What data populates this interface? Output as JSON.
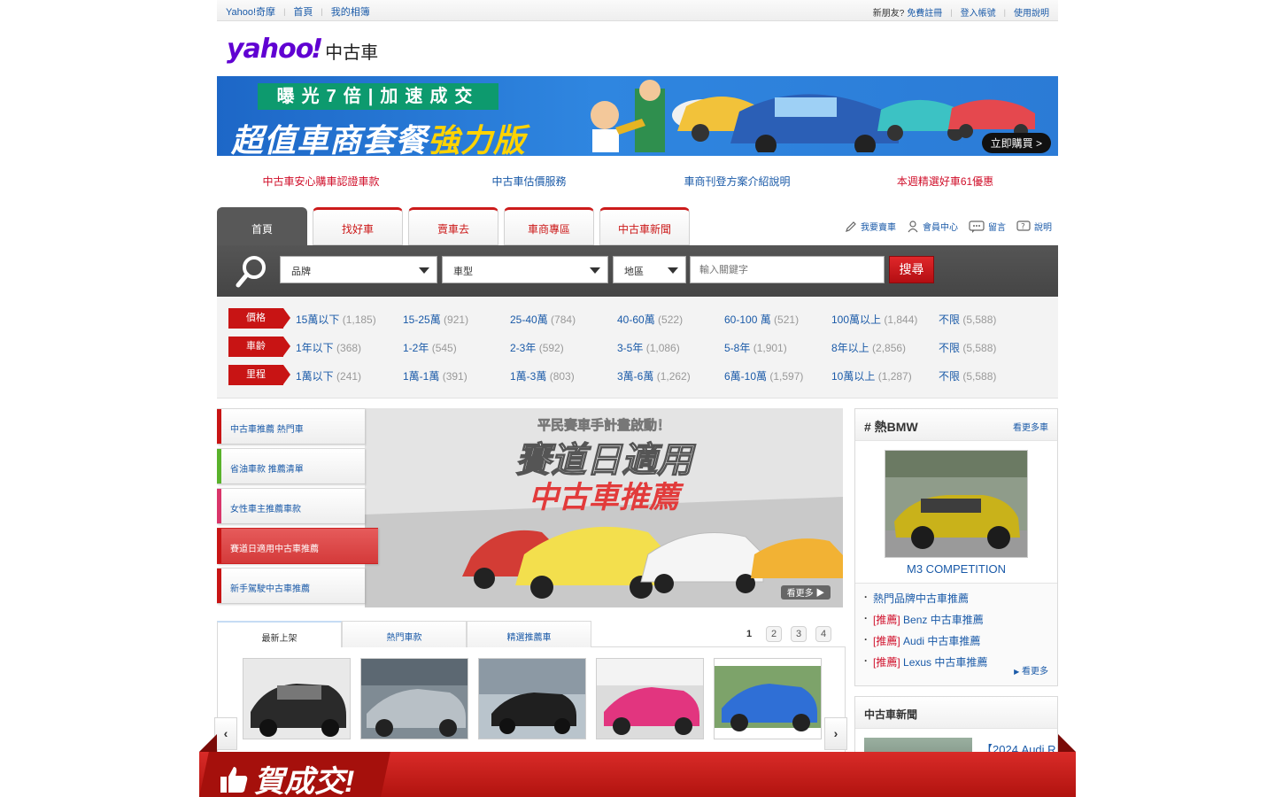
{
  "topbar": {
    "left_items": [
      "Yahoo!奇摩",
      "首頁",
      "我的相簿"
    ],
    "question": "新朋友?",
    "right_items": [
      "免費註冊",
      "登入帳號",
      "使用說明"
    ]
  },
  "logo": {
    "brand": "yahoo",
    "suffix": "中古車"
  },
  "banner": {
    "strip_text": "曝光7倍|加速成交",
    "headline_main": "超值車商套餐",
    "headline_accent": "強力版",
    "cta": "立即購買 >",
    "colors": {
      "accent": "#ffd300",
      "strip": "#0d9a6e"
    }
  },
  "notices": [
    {
      "text": "中古車安心購車認證車款",
      "color": "red"
    },
    {
      "text": "中古車估價服務",
      "color": "blue"
    },
    {
      "text": "車商刊登方案介紹說明",
      "color": "blue"
    },
    {
      "text": "本週精選好車61優惠",
      "color": "red"
    }
  ],
  "tabs": [
    "首頁",
    "找好車",
    "賣車去",
    "車商專區",
    "中古車新聞"
  ],
  "tools": [
    "我要賣車",
    "會員中心",
    "留言",
    "說明"
  ],
  "search": {
    "select1": "品牌",
    "select2": "車型",
    "select3": "地區",
    "keyword_placeholder": "輸入關鍵字",
    "button": "搜尋"
  },
  "filters": [
    {
      "label": "價格",
      "options": [
        {
          "text": "15萬以下",
          "count": "(1,185)"
        },
        {
          "text": "15-25萬",
          "count": "(921)"
        },
        {
          "text": "25-40萬",
          "count": "(784)"
        },
        {
          "text": "40-60萬",
          "count": "(522)"
        },
        {
          "text": "60-100 萬",
          "count": "(521)"
        },
        {
          "text": "100萬以上",
          "count": "(1,844)"
        },
        {
          "text": "不限",
          "count": "(5,588)"
        }
      ]
    },
    {
      "label": "車齡",
      "options": [
        {
          "text": "1年以下",
          "count": "(368)"
        },
        {
          "text": "1-2年",
          "count": "(545)"
        },
        {
          "text": "2-3年",
          "count": "(592)"
        },
        {
          "text": "3-5年",
          "count": "(1,086)"
        },
        {
          "text": "5-8年",
          "count": "(1,901)"
        },
        {
          "text": "8年以上",
          "count": "(2,856)"
        },
        {
          "text": "不限",
          "count": "(5,588)"
        }
      ]
    },
    {
      "label": "里程",
      "options": [
        {
          "text": "1萬以下",
          "count": "(241)"
        },
        {
          "text": "1萬-1萬",
          "count": "(391)"
        },
        {
          "text": "1萬-3萬",
          "count": "(803)"
        },
        {
          "text": "3萬-6萬",
          "count": "(1,262)"
        },
        {
          "text": "6萬-10萬",
          "count": "(1,597)"
        },
        {
          "text": "10萬以上",
          "count": "(1,287)"
        },
        {
          "text": "不限",
          "count": "(5,588)"
        }
      ]
    }
  ],
  "categories": [
    {
      "text": "中古車推薦 熱門車",
      "bar": "#c81414"
    },
    {
      "text": "省油車款 推薦清單",
      "bar": "#59b22b"
    },
    {
      "text": "女性車主推薦車款",
      "bar": "#d9356a"
    },
    {
      "text": "賽道日適用中古車推薦",
      "bar": "#c81414",
      "active": true
    },
    {
      "text": "新手駕駛中古車推薦",
      "bar": "#c81414"
    }
  ],
  "promo": {
    "line1": "平民賽車手計畫啟動！",
    "line2": "賽道日適用",
    "line3": "中古車推薦",
    "more": "看更多 ▶"
  },
  "featured": {
    "title": "# 熱BMW",
    "more": "看更多車",
    "caption": "M3 COMPETITION",
    "links": [
      {
        "tag": "",
        "text": "熱門品牌中古車推薦"
      },
      {
        "tag": "[推薦]",
        "text": "Benz 中古車推薦"
      },
      {
        "tag": "[推薦]",
        "text": "Audi 中古車推薦"
      },
      {
        "tag": "[推薦]",
        "text": "Lexus 中古車推薦"
      }
    ],
    "more2": "看更多"
  },
  "news": {
    "title": "中古車新聞",
    "item": "【2024 Audi R"
  },
  "listing": {
    "tabs": [
      "最新上架",
      "熱門車款",
      "精選推薦車"
    ],
    "pages": [
      "1",
      "2",
      "3",
      "4"
    ],
    "current_page": "1"
  },
  "bottom": {
    "label": "賀成交!"
  }
}
